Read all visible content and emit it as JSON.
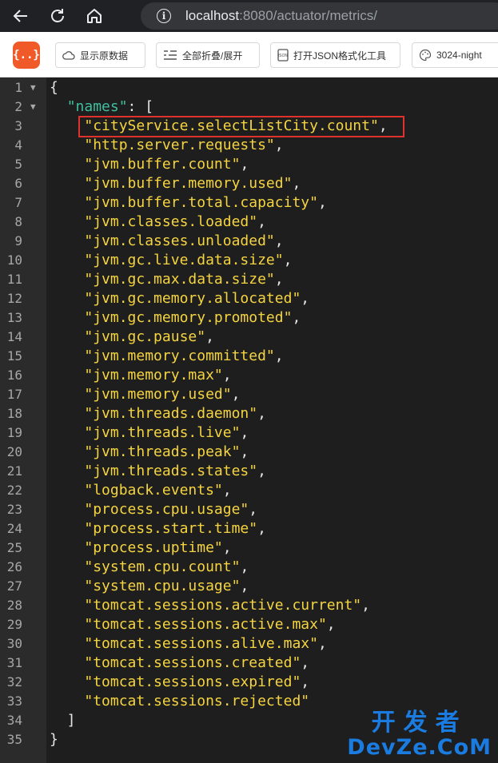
{
  "browser": {
    "url_host": "localhost",
    "url_rest": ":8080/actuator/metrics/"
  },
  "toolbar": {
    "logo": "{..}",
    "buttons": [
      "显示原数据",
      "全部折叠/展开",
      "打开JSON格式化工具",
      "3024-night"
    ]
  },
  "editor": {
    "lines": [
      {
        "n": "1",
        "fold": true,
        "code": "{"
      },
      {
        "n": "2",
        "fold": true,
        "key": "names",
        "code": "[ "
      },
      {
        "n": "3",
        "value": "cityService.selectListCity.count",
        "comma": true
      },
      {
        "n": "4",
        "value": "http.server.requests",
        "comma": true
      },
      {
        "n": "5",
        "value": "jvm.buffer.count",
        "comma": true
      },
      {
        "n": "6",
        "value": "jvm.buffer.memory.used",
        "comma": true
      },
      {
        "n": "7",
        "value": "jvm.buffer.total.capacity",
        "comma": true
      },
      {
        "n": "8",
        "value": "jvm.classes.loaded",
        "comma": true
      },
      {
        "n": "9",
        "value": "jvm.classes.unloaded",
        "comma": true
      },
      {
        "n": "10",
        "value": "jvm.gc.live.data.size",
        "comma": true
      },
      {
        "n": "11",
        "value": "jvm.gc.max.data.size",
        "comma": true
      },
      {
        "n": "12",
        "value": "jvm.gc.memory.allocated",
        "comma": true
      },
      {
        "n": "13",
        "value": "jvm.gc.memory.promoted",
        "comma": true
      },
      {
        "n": "14",
        "value": "jvm.gc.pause",
        "comma": true
      },
      {
        "n": "15",
        "value": "jvm.memory.committed",
        "comma": true
      },
      {
        "n": "16",
        "value": "jvm.memory.max",
        "comma": true
      },
      {
        "n": "17",
        "value": "jvm.memory.used",
        "comma": true
      },
      {
        "n": "18",
        "value": "jvm.threads.daemon",
        "comma": true
      },
      {
        "n": "19",
        "value": "jvm.threads.live",
        "comma": true
      },
      {
        "n": "20",
        "value": "jvm.threads.peak",
        "comma": true
      },
      {
        "n": "21",
        "value": "jvm.threads.states",
        "comma": true
      },
      {
        "n": "22",
        "value": "logback.events",
        "comma": true
      },
      {
        "n": "23",
        "value": "process.cpu.usage",
        "comma": true
      },
      {
        "n": "24",
        "value": "process.start.time",
        "comma": true
      },
      {
        "n": "25",
        "value": "process.uptime",
        "comma": true
      },
      {
        "n": "26",
        "value": "system.cpu.count",
        "comma": true
      },
      {
        "n": "27",
        "value": "system.cpu.usage",
        "comma": true
      },
      {
        "n": "28",
        "value": "tomcat.sessions.active.current",
        "comma": true
      },
      {
        "n": "29",
        "value": "tomcat.sessions.active.max",
        "comma": true
      },
      {
        "n": "30",
        "value": "tomcat.sessions.alive.max",
        "comma": true
      },
      {
        "n": "31",
        "value": "tomcat.sessions.created",
        "comma": true
      },
      {
        "n": "32",
        "value": "tomcat.sessions.expired",
        "comma": true
      },
      {
        "n": "33",
        "value": "tomcat.sessions.rejected",
        "comma": false
      },
      {
        "n": "34",
        "code": "  ]"
      },
      {
        "n": "35",
        "code": "}"
      }
    ]
  },
  "watermark": {
    "line1": "开发者",
    "line2": "DevZe.CoM"
  },
  "colors": {
    "key": "#3fbf9f",
    "string": "#f5d441",
    "highlight": "#e0322c",
    "accent": "#f05a28"
  }
}
